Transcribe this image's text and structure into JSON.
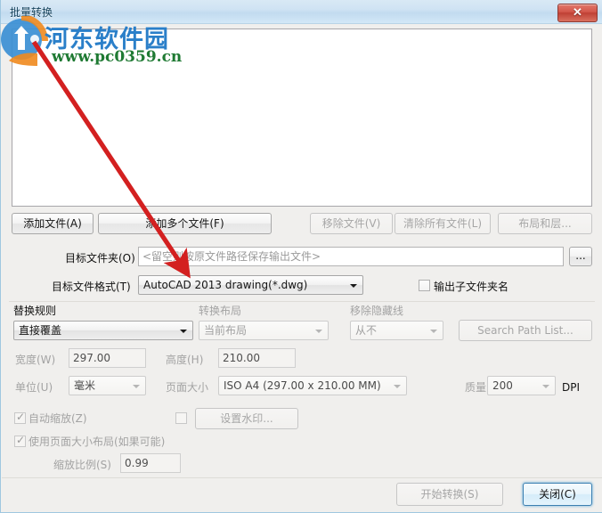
{
  "window": {
    "title": "批量转换",
    "close_button": {
      "name": "close",
      "glyph": "✕"
    }
  },
  "watermark": {
    "site_name": "河东软件园",
    "site_url": "www.pc0359.cn"
  },
  "file_list": {
    "items": [],
    "empty": true
  },
  "toolbar_buttons": [
    {
      "label": "添加文件(A)",
      "enabled": true
    },
    {
      "label": "添加多个文件(F)",
      "enabled": true
    },
    {
      "label": "移除文件(V)",
      "enabled": false
    },
    {
      "label": "清除所有文件(L)",
      "enabled": false
    },
    {
      "label": "布局和层...",
      "enabled": false
    }
  ],
  "target_folder": {
    "label": "目标文件夹(O)",
    "value": "",
    "placeholder": "<留空则按原文件路径保存输出文件>",
    "browse_button": "..."
  },
  "target_format": {
    "label": "目标文件格式(T)",
    "value": "AutoCAD 2013 drawing(*.dwg)",
    "options": [
      "AutoCAD 2013 drawing(*.dwg)"
    ]
  },
  "output_subfolder": {
    "label": "输出子文件夹名",
    "checked": false,
    "enabled": true
  },
  "replace_rule": {
    "label": "替换规则",
    "value": "直接覆盖",
    "enabled": true
  },
  "convert_layout": {
    "label": "转换布局",
    "value": "当前布局",
    "enabled": false
  },
  "remove_hidden_lines": {
    "label": "移除隐藏线",
    "value": "从不",
    "enabled": false
  },
  "search_path_button": {
    "label": "Search Path List...",
    "enabled": false
  },
  "width_field": {
    "label": "宽度(W)",
    "value": "297.00",
    "enabled": false
  },
  "height_field": {
    "label": "高度(H)",
    "value": "210.00",
    "enabled": false
  },
  "unit_field": {
    "label": "单位(U)",
    "value": "毫米",
    "enabled": false
  },
  "page_size": {
    "label": "页面大小",
    "value": "ISO A4 (297.00 x 210.00 MM)",
    "enabled": false
  },
  "quality": {
    "label": "质量",
    "value": "200",
    "unit": "DPI",
    "enabled": false
  },
  "auto_scale": {
    "label": "自动缩放(Z)",
    "checked": true,
    "enabled": false
  },
  "use_page_layout": {
    "label": "使用页面大小布局(如果可能)",
    "checked": true,
    "enabled": false
  },
  "watermark_option": {
    "label": "设置水印...",
    "checked": false,
    "enabled": false
  },
  "scale_ratio": {
    "label": "缩放比例(S)",
    "value": "0.99",
    "enabled": false
  },
  "action_buttons": {
    "start": {
      "label": "开始转换(S)",
      "enabled": false
    },
    "close": {
      "label": "关闭(C)",
      "enabled": true,
      "is_default": true
    }
  },
  "colors": {
    "title_bar": "#cfe3f3",
    "close_red": "#bf4034",
    "default_button_border": "#3c7fb1",
    "annotation_arrow": "#d32020",
    "logo_blue": "#2a7fc9",
    "logo_green": "#1f7a33",
    "logo_orange": "#f08a1e"
  }
}
